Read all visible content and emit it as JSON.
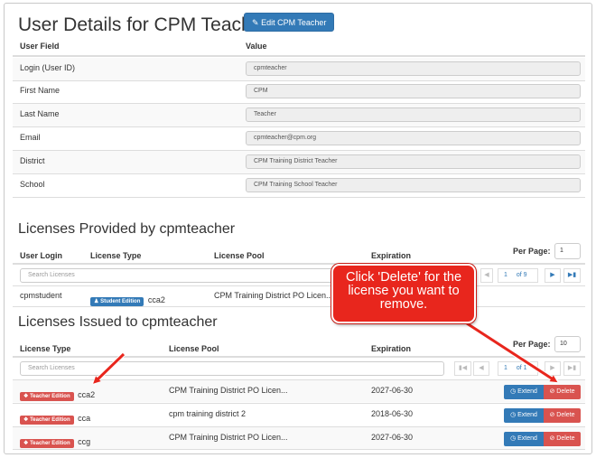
{
  "user_details": {
    "title": "User Details for CPM Teacher",
    "edit_button_label": "Edit CPM Teacher",
    "col_field": "User Field",
    "col_value": "Value",
    "rows": [
      {
        "label": "Login (User ID)",
        "value": "cpmteacher"
      },
      {
        "label": "First Name",
        "value": "CPM"
      },
      {
        "label": "Last Name",
        "value": "Teacher"
      },
      {
        "label": "Email",
        "value": "cpmteacher@cpm.org"
      },
      {
        "label": "District",
        "value": "CPM Training District Teacher"
      },
      {
        "label": "School",
        "value": "CPM Training School Teacher"
      }
    ]
  },
  "provided": {
    "title": "Licenses Provided by cpmteacher",
    "headers": {
      "login": "User Login",
      "type": "License Type",
      "pool": "License Pool",
      "expiration": "Expiration"
    },
    "per_page_label": "Per Page:",
    "per_page_value": "1",
    "search_placeholder": "Search Licenses",
    "pager_page": "1",
    "pager_of": "of 9",
    "row": {
      "login": "cpmstudent",
      "badge": "Student Edition",
      "code": "cca2",
      "pool": "CPM Training District PO Licen..."
    }
  },
  "issued": {
    "title": "Licenses Issued to cpmteacher",
    "headers": {
      "type": "License Type",
      "pool": "License Pool",
      "expiration": "Expiration"
    },
    "per_page_label": "Per Page:",
    "per_page_value": "10",
    "search_placeholder": "Search Licenses",
    "pager_page": "1",
    "pager_of": "of 1",
    "extend_label": "Extend",
    "delete_label": "Delete",
    "rows": [
      {
        "badge": "Teacher Edition",
        "code": "cca2",
        "pool": "CPM Training District PO Licen...",
        "expiration": "2027-06-30"
      },
      {
        "badge": "Teacher Edition",
        "code": "cca",
        "pool": "cpm training district 2",
        "expiration": "2018-06-30"
      },
      {
        "badge": "Teacher Edition",
        "code": "ccg",
        "pool": "CPM Training District PO Licen...",
        "expiration": "2027-06-30"
      }
    ]
  },
  "callout": {
    "text": "Click 'Delete' for the license you want to remove."
  },
  "colors": {
    "primary": "#337ab7",
    "danger": "#d9534f",
    "callout": "#e8261d"
  }
}
